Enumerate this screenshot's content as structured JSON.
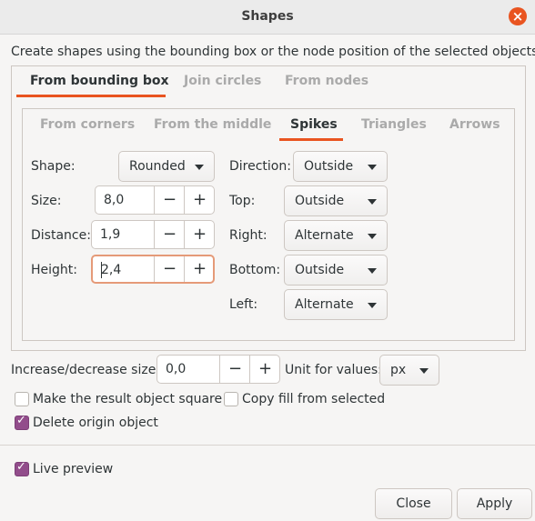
{
  "window": {
    "title": "Shapes"
  },
  "description": "Create shapes using the bounding box or the node position of the selected objects",
  "main_tabs": [
    "From bounding box",
    "Join circles",
    "From nodes"
  ],
  "sub_tabs": [
    "From corners",
    "From the middle",
    "Spikes",
    "Triangles",
    "Arrows"
  ],
  "spikes": {
    "shape_label": "Shape:",
    "shape_value": "Rounded",
    "size_label": "Size:",
    "size_value": "8,0",
    "distance_label": "Distance:",
    "distance_value": "1,9",
    "height_label": "Height:",
    "height_value": "2,4",
    "direction_label": "Direction:",
    "direction_value": "Outside",
    "top_label": "Top:",
    "top_value": "Outside",
    "right_label": "Right:",
    "right_value": "Alternate",
    "bottom_label": "Bottom:",
    "bottom_value": "Outside",
    "left_label": "Left:",
    "left_value": "Alternate"
  },
  "common": {
    "increase_label": "Increase/decrease size:",
    "increase_value": "0,0",
    "unit_label": "Unit for values:",
    "unit_value": "px",
    "make_square_label": "Make the result object square",
    "make_square_checked": false,
    "copy_fill_label": "Copy fill from selected",
    "copy_fill_checked": false,
    "delete_origin_label": "Delete origin object",
    "delete_origin_checked": true,
    "live_preview_label": "Live preview",
    "live_preview_checked": true
  },
  "spin_minus": "−",
  "spin_plus": "+",
  "buttons": {
    "close": "Close",
    "apply": "Apply"
  },
  "colors": {
    "accent": "#e95420",
    "check": "#924d8b"
  }
}
